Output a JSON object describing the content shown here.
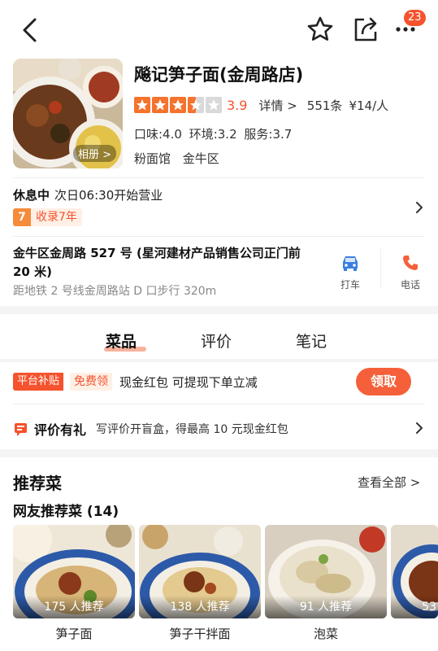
{
  "header": {
    "notification_count": "23"
  },
  "shop": {
    "name": "飚记笋子面(金周路店)",
    "album_label": "相册 >",
    "rating_stars": 3.5,
    "score": "3.9",
    "details_label": "详情 >",
    "review_count": "551条",
    "price": "¥14/人",
    "taste": "口味:4.0",
    "environment": "环境:3.2",
    "service": "服务:3.7",
    "category": "粉面馆",
    "district": "金牛区"
  },
  "hours": {
    "status": "休息中",
    "next_open": "次日06:30开始营业",
    "years_number": "7",
    "years_label": "收录7年"
  },
  "address": {
    "text": "金牛区金周路 527 号 (星河建材产品销售公司正门前 20 米)",
    "subway": "距地铁 2 号线金周路站 D 口步行 320m",
    "taxi_label": "打车",
    "phone_label": "电话"
  },
  "tabs": [
    {
      "label": "菜品",
      "active": true
    },
    {
      "label": "评价",
      "active": false
    },
    {
      "label": "笔记",
      "active": false
    }
  ],
  "promo": {
    "tag": "平台补贴",
    "free": "免费领",
    "text": "现金红包 可提现下单立减",
    "button": "领取"
  },
  "review_gift": {
    "title": "评价有礼",
    "desc": "写评价开盲盒，得最高 10 元现金红包"
  },
  "recommended": {
    "title": "推荐菜",
    "see_all": "查看全部 >",
    "subtitle": "网友推荐菜 (14)",
    "dishes": [
      {
        "name": "笋子面",
        "count": "175 人推荐"
      },
      {
        "name": "笋子干拌面",
        "count": "138 人推荐"
      },
      {
        "name": "泡菜",
        "count": "91 人推荐"
      },
      {
        "name": "",
        "count": "53"
      }
    ]
  },
  "colors": {
    "accent": "#f5522d",
    "star": "#f5732d"
  }
}
